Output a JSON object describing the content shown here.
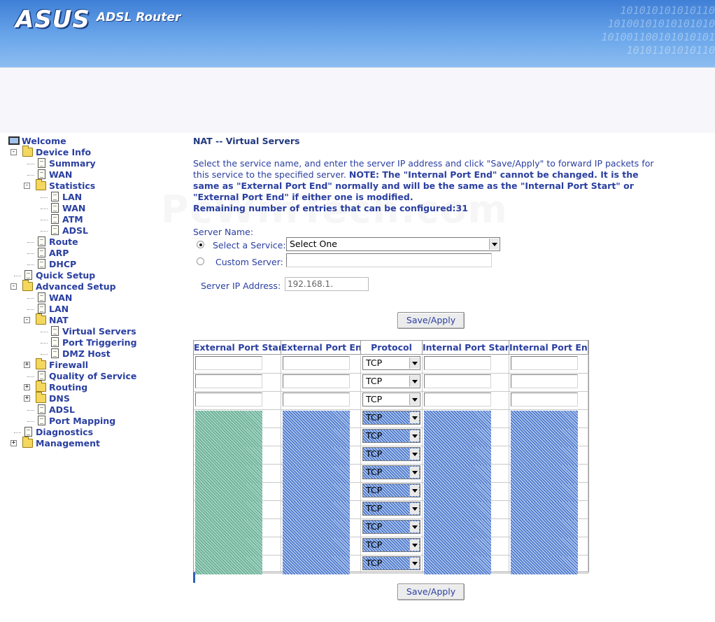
{
  "banner": {
    "brand": "ASUS",
    "product": "ADSL Router",
    "binary_lines": [
      "101010101010110",
      "10100101010101010",
      "101001100101010101",
      "10101101010110"
    ]
  },
  "nav": {
    "items": [
      {
        "label": "Welcome",
        "icon": "computer-icon",
        "level": 0
      },
      {
        "label": "Device Info",
        "icon": "folder-open-icon",
        "level": 0,
        "toggle": "−"
      },
      {
        "label": "Summary",
        "icon": "document-icon",
        "level": 1
      },
      {
        "label": "WAN",
        "icon": "document-icon",
        "level": 1
      },
      {
        "label": "Statistics",
        "icon": "folder-open-icon",
        "level": 1,
        "toggle": "−"
      },
      {
        "label": "LAN",
        "icon": "document-icon",
        "level": 2
      },
      {
        "label": "WAN",
        "icon": "document-icon",
        "level": 2
      },
      {
        "label": "ATM",
        "icon": "document-icon",
        "level": 2
      },
      {
        "label": "ADSL",
        "icon": "document-icon",
        "level": 2
      },
      {
        "label": "Route",
        "icon": "document-icon",
        "level": 1
      },
      {
        "label": "ARP",
        "icon": "document-icon",
        "level": 1
      },
      {
        "label": "DHCP",
        "icon": "document-icon",
        "level": 1
      },
      {
        "label": "Quick Setup",
        "icon": "document-icon",
        "level": 0
      },
      {
        "label": "Advanced Setup",
        "icon": "folder-open-icon",
        "level": 0,
        "toggle": "−"
      },
      {
        "label": "WAN",
        "icon": "document-icon",
        "level": 1
      },
      {
        "label": "LAN",
        "icon": "document-icon",
        "level": 1
      },
      {
        "label": "NAT",
        "icon": "folder-open-icon",
        "level": 1,
        "toggle": "−"
      },
      {
        "label": "Virtual Servers",
        "icon": "document-icon",
        "level": 2
      },
      {
        "label": "Port Triggering",
        "icon": "document-icon",
        "level": 2
      },
      {
        "label": "DMZ Host",
        "icon": "document-icon",
        "level": 2
      },
      {
        "label": "Firewall",
        "icon": "folder-closed-icon",
        "level": 1,
        "toggle": "+"
      },
      {
        "label": "Quality of Service",
        "icon": "document-icon",
        "level": 1
      },
      {
        "label": "Routing",
        "icon": "folder-closed-icon",
        "level": 1,
        "toggle": "+"
      },
      {
        "label": "DNS",
        "icon": "folder-closed-icon",
        "level": 1,
        "toggle": "+"
      },
      {
        "label": "ADSL",
        "icon": "document-icon",
        "level": 1
      },
      {
        "label": "Port Mapping",
        "icon": "document-icon",
        "level": 1
      },
      {
        "label": "Diagnostics",
        "icon": "document-icon",
        "level": 0
      },
      {
        "label": "Management",
        "icon": "folder-closed-icon",
        "level": 0,
        "toggle": "+"
      }
    ]
  },
  "page": {
    "title": "NAT -- Virtual Servers",
    "desc_plain": "Select the service name, and enter the server IP address and click \"Save/Apply\" to forward IP packets for this service to the specified server. ",
    "desc_note": "NOTE: The \"Internal Port End\" cannot be changed. It is the same as \"External Port End\" normally and will be the same as the \"Internal Port Start\" or \"External Port End\" if either one is modified.",
    "remaining": "Remaining number of entries that can be configured:31",
    "server_name_label": "Server Name:",
    "select_service_label": "Select a Service:",
    "select_service_value": "Select One",
    "custom_server_label": "Custom Server:",
    "custom_server_value": "",
    "server_ip_label": "Server IP Address:",
    "server_ip_value": "192.168.1.",
    "save_apply": "Save/Apply"
  },
  "table": {
    "headers": [
      "External Port Start",
      "External Port End",
      "Protocol",
      "Internal Port Start",
      "Internal Port End"
    ],
    "protocol_value": "TCP",
    "row_count": 12
  },
  "watermark": "PcWinTech.com"
}
